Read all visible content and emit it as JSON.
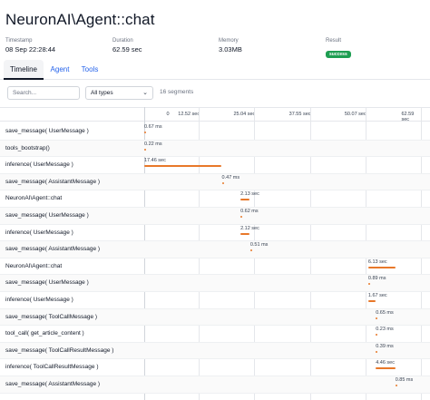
{
  "title": "NeuronAI\\Agent::chat",
  "meta": [
    {
      "label": "Timestamp",
      "value": "08 Sep 22:28:44"
    },
    {
      "label": "Duration",
      "value": "62.59 sec"
    },
    {
      "label": "Memory",
      "value": "3.03MB"
    }
  ],
  "result": {
    "label": "Result",
    "value": "success",
    "color": "#1e9e52"
  },
  "tabs": [
    {
      "label": "Timeline",
      "active": true
    },
    {
      "label": "Agent",
      "active": false
    },
    {
      "label": "Tools",
      "active": false
    }
  ],
  "toolbar": {
    "search_placeholder": "Search...",
    "type_filter": "All types",
    "segment_count": "16 segments"
  },
  "timeline": {
    "total_sec": 62.59,
    "ticks": [
      "0",
      "12.52 sec",
      "25.04 sec",
      "37.55 sec",
      "50.07 sec",
      "62.59 sec"
    ],
    "bar_color": "#e8782a",
    "segments": [
      {
        "label": "save_message( UserMessage )",
        "start_sec": 0.0,
        "duration_sec": 0.00067,
        "duration_label": "0.67 ms"
      },
      {
        "label": "tools_bootstrap()",
        "start_sec": 0.0,
        "duration_sec": 0.00022,
        "duration_label": "0.22 ms"
      },
      {
        "label": "inference( UserMessage )",
        "start_sec": 0.0,
        "duration_sec": 17.46,
        "duration_label": "17.46 sec"
      },
      {
        "label": "save_message( AssistantMessage )",
        "start_sec": 17.5,
        "duration_sec": 0.00047,
        "duration_label": "0.47 ms"
      },
      {
        "label": "NeuronAI\\Agent::chat",
        "start_sec": 21.7,
        "duration_sec": 2.13,
        "duration_label": "2.13 sec"
      },
      {
        "label": "save_message( UserMessage )",
        "start_sec": 21.7,
        "duration_sec": 0.00062,
        "duration_label": "0.62 ms"
      },
      {
        "label": "inference( UserMessage )",
        "start_sec": 21.7,
        "duration_sec": 2.12,
        "duration_label": "2.12 sec"
      },
      {
        "label": "save_message( AssistantMessage )",
        "start_sec": 23.9,
        "duration_sec": 0.00051,
        "duration_label": "0.51 ms"
      },
      {
        "label": "NeuronAI\\Agent::chat",
        "start_sec": 50.5,
        "duration_sec": 6.13,
        "duration_label": "6.13 sec"
      },
      {
        "label": "save_message( UserMessage )",
        "start_sec": 50.5,
        "duration_sec": 0.00089,
        "duration_label": "0.89 ms"
      },
      {
        "label": "inference( UserMessage )",
        "start_sec": 50.5,
        "duration_sec": 1.67,
        "duration_label": "1.67 sec"
      },
      {
        "label": "save_message( ToolCallMessage )",
        "start_sec": 52.2,
        "duration_sec": 0.00065,
        "duration_label": "0.65 ms"
      },
      {
        "label": "tool_call( get_article_content )",
        "start_sec": 52.2,
        "duration_sec": 0.00023,
        "duration_label": "0.23 ms"
      },
      {
        "label": "save_message( ToolCallResultMessage )",
        "start_sec": 52.2,
        "duration_sec": 0.00039,
        "duration_label": "0.39 ms"
      },
      {
        "label": "inference( ToolCallResultMessage )",
        "start_sec": 52.2,
        "duration_sec": 4.46,
        "duration_label": "4.46 sec"
      },
      {
        "label": "save_message( AssistantMessage )",
        "start_sec": 56.6,
        "duration_sec": 0.00085,
        "duration_label": "0.85 ms"
      }
    ]
  }
}
